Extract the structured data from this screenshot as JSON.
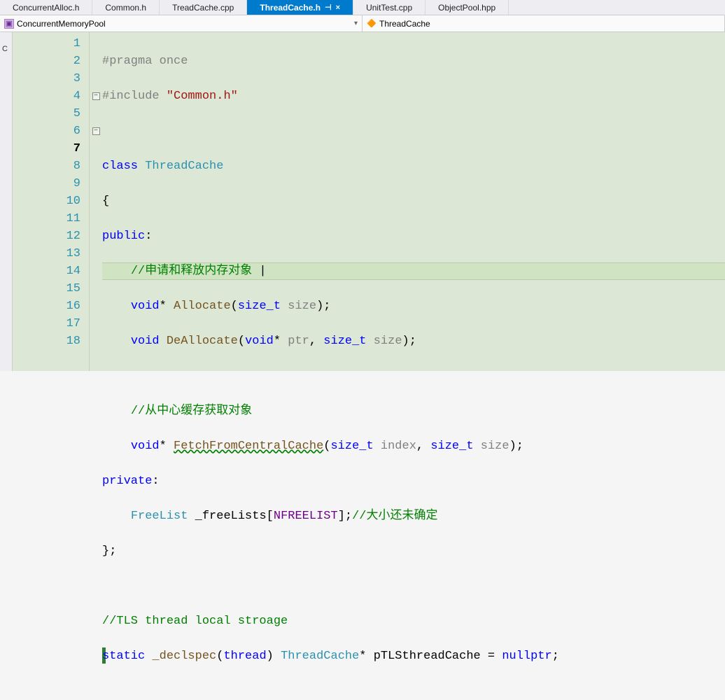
{
  "tabs": [
    {
      "label": "ConcurrentAlloc.h"
    },
    {
      "label": "Common.h"
    },
    {
      "label": "TreadCache.cpp"
    },
    {
      "label": "ThreadCache.h",
      "active": true
    },
    {
      "label": "UnitTest.cpp"
    },
    {
      "label": "ObjectPool.hpp"
    }
  ],
  "pin_glyph": "⊣",
  "close_glyph": "×",
  "nav": {
    "scope1": "ConcurrentMemoryPool",
    "scope2": "ThreadCache"
  },
  "left_strip": "C",
  "lines": [
    "1",
    "2",
    "3",
    "4",
    "5",
    "6",
    "7",
    "8",
    "9",
    "10",
    "11",
    "12",
    "13",
    "14",
    "15",
    "16",
    "17",
    "18"
  ],
  "current_line_index": 6,
  "fold_at": {
    "3": "−",
    "5": "−"
  },
  "code": {
    "l1_pp": "#pragma",
    "l1_pp2": "once",
    "l2_pp": "#include",
    "l2_str": "\"Common.h\"",
    "l4_kw": "class",
    "l4_type": "ThreadCache",
    "l5": "{",
    "l6_kw": "public",
    "l6_colon": ":",
    "l7_cm": "//申请和释放内存对象 ",
    "l8_kw": "void",
    "l8_star": "*",
    "l8_fn": "Allocate",
    "l8_p1t": "size_t",
    "l8_p1n": "size",
    "l9_kw": "void",
    "l9_fn": "DeAllocate",
    "l9_p1t": "void",
    "l9_star": "*",
    "l9_p1n": "ptr",
    "l9_p2t": "size_t",
    "l9_p2n": "size",
    "l11_cm": "//从中心缓存获取对象",
    "l12_kw": "void",
    "l12_star": "*",
    "l12_fn": "FetchFromCentralCache",
    "l12_p1t": "size_t",
    "l12_p1n": "index",
    "l12_p2t": "size_t",
    "l12_p2n": "size",
    "l13_kw": "private",
    "l13_colon": ":",
    "l14_type": "FreeList",
    "l14_id": "_freeLists",
    "l14_def": "NFREELIST",
    "l14_cm": "//大小还未确定",
    "l15": "};",
    "l17_cm": "//TLS thread local stroage",
    "l18_kw1": "static",
    "l18_fn": "_declspec",
    "l18_kw2": "thread",
    "l18_type": "ThreadCache",
    "l18_star": "*",
    "l18_id": "pTLSthreadCache",
    "l18_eq": " = ",
    "l18_kw3": "nullptr",
    "cursor": "|"
  }
}
